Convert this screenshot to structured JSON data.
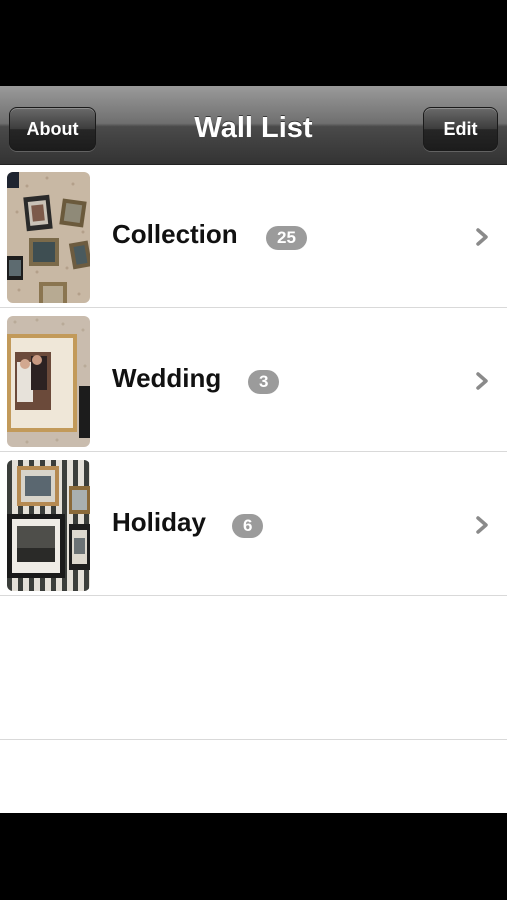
{
  "nav": {
    "title": "Wall List",
    "left_button": "About",
    "right_button": "Edit"
  },
  "walls": [
    {
      "name": "Collection",
      "count": "25",
      "thumbnail": "collection-wall-photo"
    },
    {
      "name": "Wedding",
      "count": "3",
      "thumbnail": "wedding-wall-photo"
    },
    {
      "name": "Holiday",
      "count": "6",
      "thumbnail": "holiday-wall-photo"
    }
  ],
  "icons": {
    "disclosure": "chevron-right-icon"
  },
  "colors": {
    "nav_bar": "#5a5a5a",
    "count_badge": "#9b9b9b",
    "chevron": "#8a8a8a"
  }
}
